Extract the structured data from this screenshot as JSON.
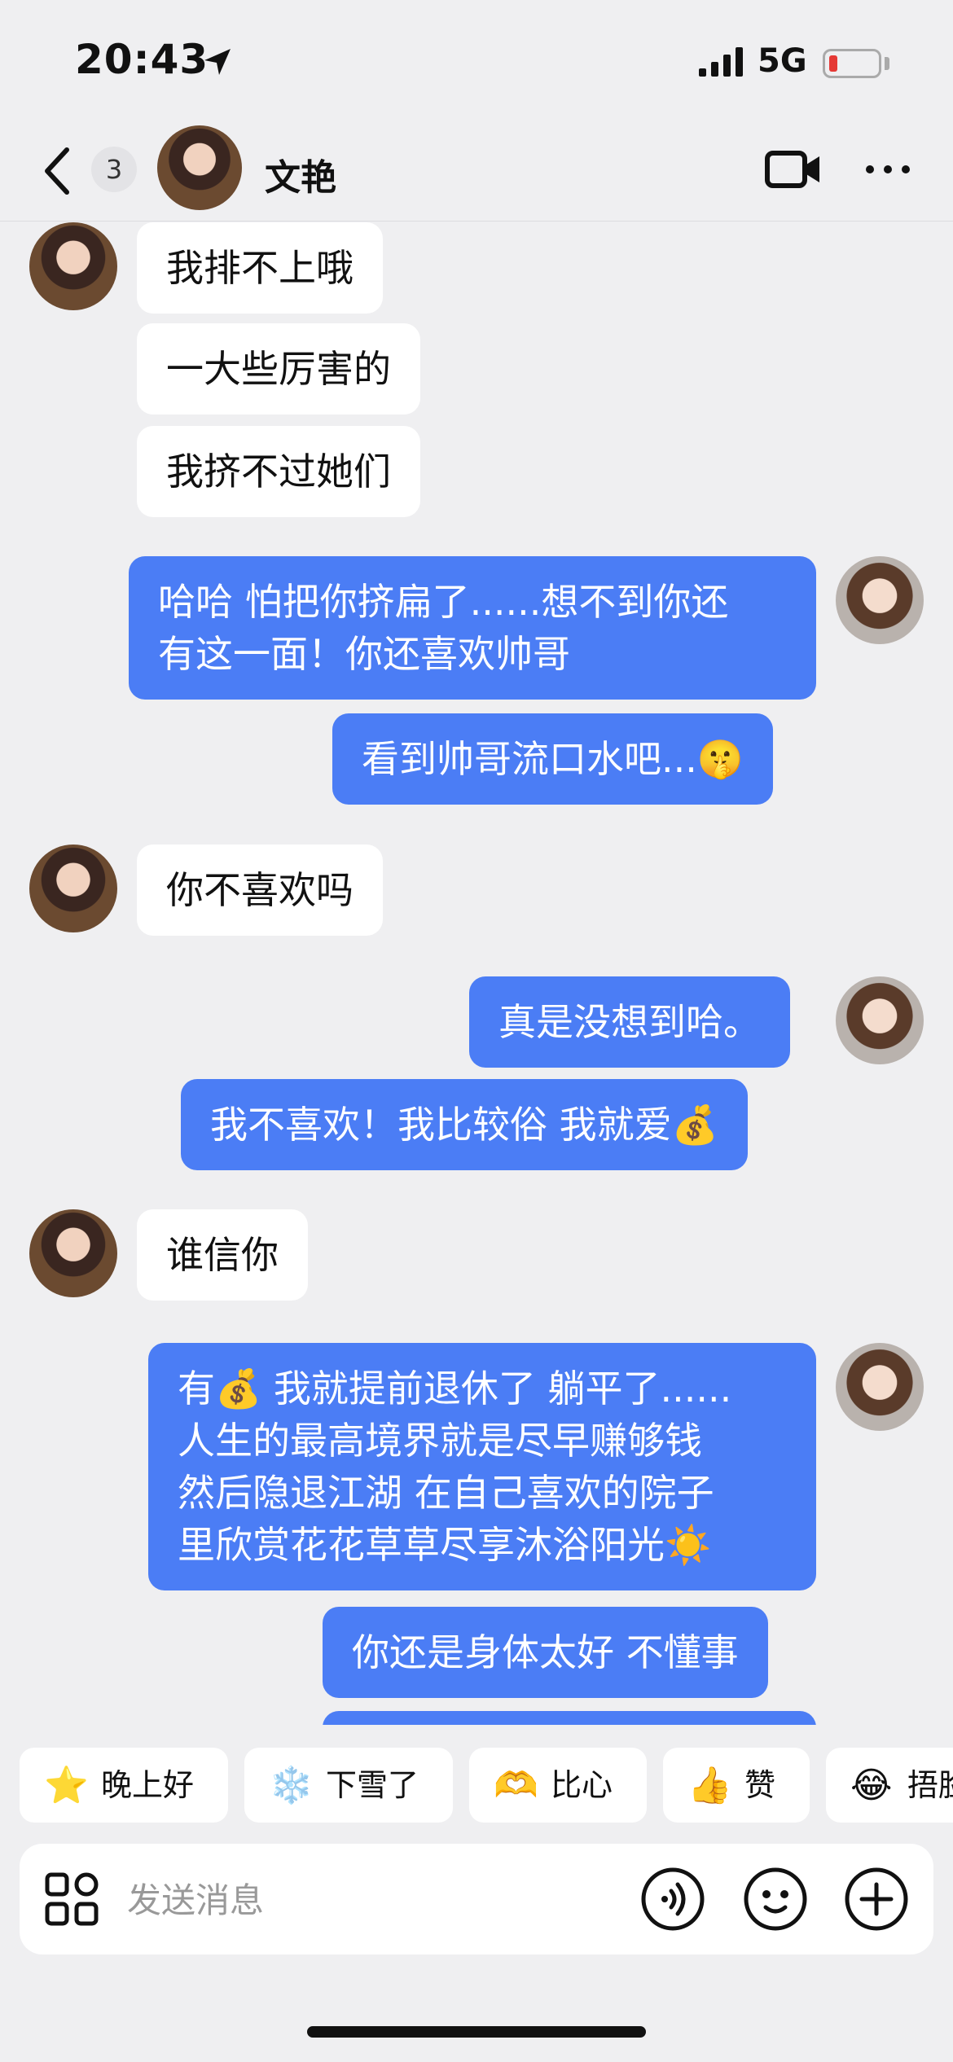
{
  "status_bar": {
    "time": "20:43",
    "network": "5G"
  },
  "header": {
    "unread_count": "3",
    "contact_name": "文艳"
  },
  "messages": [
    {
      "side": "in",
      "text": "我排不上哦"
    },
    {
      "side": "in",
      "text": "一大些厉害的"
    },
    {
      "side": "in",
      "text": "我挤不过她们"
    },
    {
      "side": "out",
      "text": "哈哈 怕把你挤扁了......想不到你还\n有这一面！你还喜欢帅哥"
    },
    {
      "side": "out",
      "text": "看到帅哥流口水吧...🤫"
    },
    {
      "side": "in",
      "text": "你不喜欢吗"
    },
    {
      "side": "out",
      "text": "真是没想到哈。"
    },
    {
      "side": "out",
      "text": "我不喜欢！我比较俗 我就爱💰"
    },
    {
      "side": "in",
      "text": "谁信你"
    },
    {
      "side": "out",
      "text": "有💰 我就提前退休了 躺平了......\n人生的最高境界就是尽早赚够钱\n然后隐退江湖 在自己喜欢的院子\n里欣赏花花草草尽享沐浴阳光☀️"
    },
    {
      "side": "out",
      "text": "你还是身体太好 不懂事"
    }
  ],
  "quick_replies": [
    {
      "emoji": "⭐",
      "label": "晚上好"
    },
    {
      "emoji": "❄️",
      "label": "下雪了"
    },
    {
      "emoji": "🫶",
      "label": "比心"
    },
    {
      "emoji": "👍",
      "label": "赞"
    },
    {
      "emoji": "😂",
      "label": "捂脸"
    }
  ],
  "input": {
    "placeholder": "发送消息"
  },
  "icons": {
    "back": "chevron-left-icon",
    "video": "video-camera-icon",
    "more": "more-dots-icon",
    "apps": "apps-grid-icon",
    "voice": "voice-icon",
    "emoji": "emoji-icon",
    "add": "plus-icon"
  },
  "colors": {
    "outgoing_bubble": "#4b7df5",
    "incoming_bubble": "#ffffff",
    "background": "#efeff1"
  }
}
